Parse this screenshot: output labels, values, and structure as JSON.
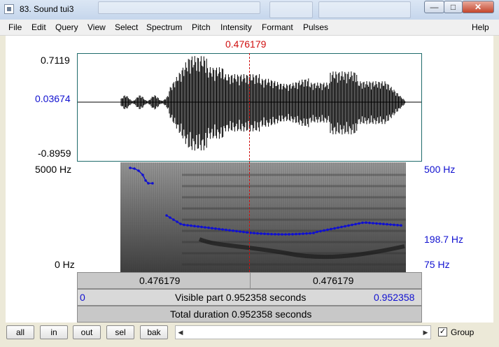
{
  "window": {
    "title": "83. Sound tui3",
    "close_glyph": "✕",
    "minimize_glyph": "—",
    "maximize_glyph": "□"
  },
  "menu": [
    "File",
    "Edit",
    "Query",
    "View",
    "Select",
    "Spectrum",
    "Pitch",
    "Intensity",
    "Formant",
    "Pulses"
  ],
  "help": "Help",
  "cursor_time": "0.476179",
  "waveform": {
    "max": "0.7119",
    "cursor_value": "0.03674",
    "min": "-0.8959"
  },
  "spectrogram": {
    "freq_top": "5000 Hz",
    "freq_bottom": "0 Hz"
  },
  "pitch": {
    "top": "500 Hz",
    "cursor": "198.7 Hz",
    "bottom": "75 Hz",
    "color": "#1010d0"
  },
  "time_bar": {
    "left": "0.476179",
    "right": "0.476179"
  },
  "visible_bar": {
    "start": "0",
    "label": "Visible part 0.952358 seconds",
    "end": "0.952358"
  },
  "total_bar": {
    "label": "Total duration 0.952358 seconds"
  },
  "buttons": {
    "all": "all",
    "in": "in",
    "out": "out",
    "sel": "sel",
    "bak": "bak"
  },
  "scroll": {
    "left_arrow": "◀",
    "right_arrow": "▶"
  },
  "group": {
    "label": "Group",
    "checked": "✓"
  }
}
